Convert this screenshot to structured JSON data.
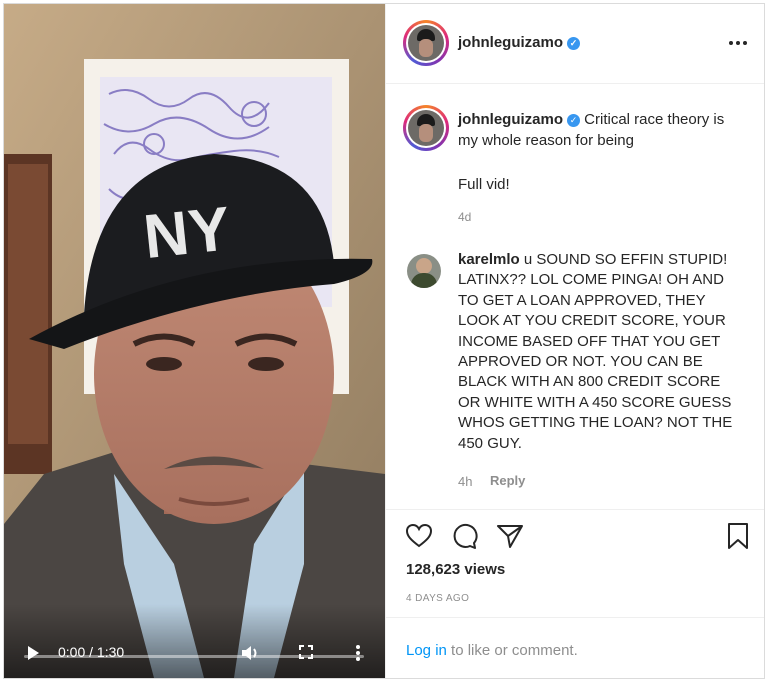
{
  "post": {
    "username": "johnleguizamo",
    "verified": true,
    "caption": "Critical race theory is my whole reason for being",
    "caption_extra": "Full vid!",
    "caption_time": "4d"
  },
  "video": {
    "time": "0:00 / 1:30",
    "progress": 0
  },
  "comment": {
    "username": "karelmlo",
    "text": "u SOUND SO EFFIN STUPID! LATINX?? LOL COME PINGA! OH AND TO GET A LOAN APPROVED, THEY LOOK AT YOU CREDIT SCORE, YOUR INCOME BASED OFF THAT YOU GET APPROVED OR NOT. YOU CAN BE BLACK WITH AN 800 CREDIT SCORE OR WHITE WITH A 450 SCORE GUESS WHOS GETTING THE LOAN? NOT THE 450 GUY.",
    "time": "4h",
    "reply_label": "Reply"
  },
  "stats": {
    "views": "128,623 views",
    "date": "4 DAYS AGO"
  },
  "login": {
    "link": "Log in",
    "rest": " to like or comment."
  },
  "colors": {
    "link": "#0095f6",
    "verified": "#3897f0",
    "muted": "#8e8e8e"
  },
  "icons": [
    "verified-badge-icon",
    "more-options-icon",
    "play-icon",
    "volume-icon",
    "fullscreen-icon",
    "video-more-icon",
    "heart-icon",
    "comment-icon",
    "share-icon",
    "bookmark-icon"
  ]
}
